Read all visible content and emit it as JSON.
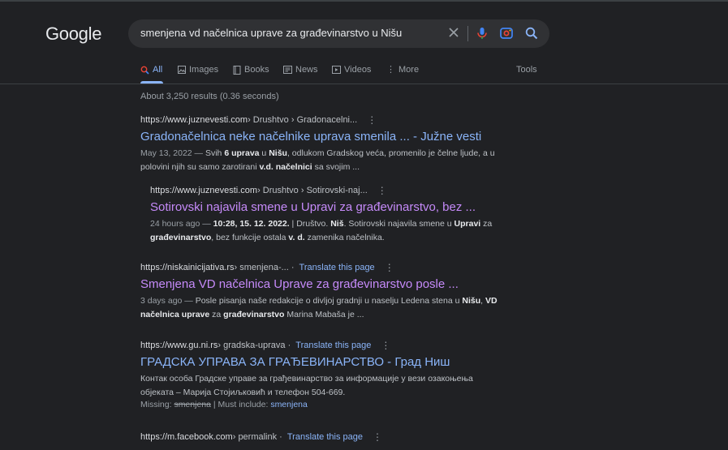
{
  "logo": "Google",
  "search": {
    "query": "smenjena vd načelnica uprave za građevinarstvo u Nišu"
  },
  "tabs": [
    "All",
    "Images",
    "Books",
    "News",
    "Videos",
    "More"
  ],
  "tools_label": "Tools",
  "stats": "About 3,250 results (0.36 seconds)",
  "results": [
    {
      "site": "https://www.juznevesti.com",
      "path": " › Drushtvo › Gradonacelni...",
      "title": "Gradonačelnica neke načelnike uprava smenila ... - Južne vesti",
      "date": "May 13, 2022 — ",
      "s1": "Svih ",
      "b1": "6 uprava",
      "s2": " u ",
      "b2": "Nišu",
      "s3": ", odlukom Gradskog veća, promenilo je čelne ljude, a u polovini njih su samo zarotirani ",
      "b3": "v.d. načelnici",
      "s4": " sa svojim ..."
    },
    {
      "site": "https://www.juznevesti.com",
      "path": " › Drushtvo › Sotirovski-naj...",
      "title": "Sotirovski najavila smene u Upravi za građevinarstvo, bez ...",
      "date": "24 hours ago — ",
      "b0": "10:28, 15. 12. 2022.",
      "s1": " | Društvo. ",
      "b1": "Niš",
      "s2": ". Sotirovski najavila smene u ",
      "b2": "Upravi",
      "s3": " za ",
      "b3": "građevinarstvo",
      "s4": ", bez funkcije ostala ",
      "b4": "v. d.",
      "s5": " zamenika načelnika."
    },
    {
      "site": "https://niskainicijativa.rs",
      "path": " › smenjena-...",
      "translate": "Translate this page",
      "title": "Smenjena VD načelnica Uprave za građevinarstvo posle ...",
      "date": "3 days ago — ",
      "s1": "Posle pisanja naše redakcije o divljoj gradnji u naselju Ledena stena u ",
      "b1": "Nišu",
      "s2": ", ",
      "b2": "VD načelnica uprave",
      "s3": " za ",
      "b3": "građevinarstvo",
      "s4": " Marina Mabaša je ..."
    },
    {
      "site": "https://www.gu.ni.rs",
      "path": " › gradska-uprava",
      "translate": "Translate this page",
      "title": "ГРАДСКА УПРАВА ЗА ГРАЂЕВИНАРСТВО - Град Ниш",
      "snippet": "Контак особа Градске управе за грађевинарство за информације у вези озакоњења објеката – Марија Стојиљковић и телефон 504-669.",
      "missing_label": "Missing: ",
      "missing_word": "smenjena",
      "must_label": " | Must include: ",
      "must_word": "smenjena"
    },
    {
      "site": "https://m.facebook.com",
      "path": " › permalink",
      "translate": "Translate this page"
    }
  ]
}
